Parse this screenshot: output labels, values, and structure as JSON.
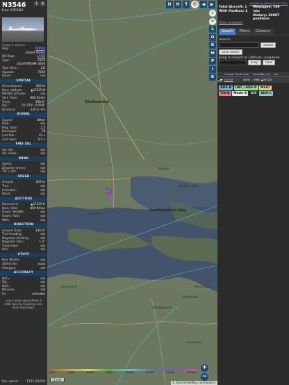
{
  "aircraft": {
    "hex_title": "N3546",
    "hex_line": "Hex:  A3F6D3",
    "photo_caption": "Image © adsc.eu",
    "details": [
      {
        "k": "Reg.:",
        "v": "N3546",
        "link": true
      },
      {
        "k": "",
        "v": "United States"
      },
      {
        "k": "DB flags:",
        "v": "LADD",
        "link": true
      },
      {
        "k": "Type:",
        "v": "GLF6"
      },
      {
        "k": "",
        "v": "GULFSTREAM G650"
      },
      {
        "k": "Type Desc.:",
        "v": "L2J"
      },
      {
        "k": "Squawk:",
        "v": "7566"
      },
      {
        "k": "Route:",
        "v": "n/a"
      }
    ]
  },
  "sections": {
    "spatial": {
      "title": "SPATIAL",
      "rows": [
        {
          "k": "Groundspeed:",
          "v": "502 kt"
        },
        {
          "k": "Baro. altitude:",
          "v": "▲37225 ft"
        },
        {
          "k": "WGS84 altitude:",
          "v": "n/a"
        },
        {
          "k": "Vert. Rate:",
          "v": "800 ft/min"
        },
        {
          "k": "Track:",
          "v": "330.0°"
        },
        {
          "k": "Pos.:",
          "v": "51.575°, 0.518°"
        },
        {
          "k": "Distance:",
          "v": "220.4 nmi"
        }
      ]
    },
    "signal": {
      "title": "SIGNAL",
      "rows": [
        {
          "k": "Source:",
          "v": "Other"
        },
        {
          "k": "RSSI:",
          "v": "n/a"
        },
        {
          "k": "Msg. Rate:",
          "v": "2.5"
        },
        {
          "k": "Messages:",
          "v": "78"
        },
        {
          "k": "Last Pos.:",
          "v": "41 s"
        },
        {
          "k": "Last Seen:",
          "v": "0.5 s"
        }
      ]
    },
    "fms": {
      "title": "FMS SEL",
      "rows": [
        {
          "k": "Sel. Alt.:",
          "v": "n/a"
        },
        {
          "k": "Sel. Head.:",
          "v": "n/a"
        }
      ]
    },
    "wind": {
      "title": "WIND",
      "rows": [
        {
          "k": "Speed:",
          "v": "n/a"
        },
        {
          "k": "Direction (from):",
          "v": "n/a"
        },
        {
          "k": "TAT / OAT:",
          "v": "n/a"
        }
      ]
    },
    "speed": {
      "title": "SPEED",
      "rows": [
        {
          "k": "Ground:",
          "v": "502 kt"
        },
        {
          "k": "True:",
          "v": "n/a"
        },
        {
          "k": "Indicated:",
          "v": "n/a"
        },
        {
          "k": "Mach:",
          "v": "n/a"
        }
      ]
    },
    "altitude": {
      "title": "ALTITUDE",
      "rows": [
        {
          "k": "Barometric:",
          "v": "▲37225 ft"
        },
        {
          "k": "Baro. Rate:",
          "v": "800 ft/min"
        },
        {
          "k": "Geom. WGS84:",
          "v": "n/a"
        },
        {
          "k": "Geom. Rate:",
          "v": "n/a"
        },
        {
          "k": "QNH:",
          "v": "n/a"
        }
      ]
    },
    "direction": {
      "title": "DIRECTION",
      "rows": [
        {
          "k": "Ground Track:",
          "v": "330.0°"
        },
        {
          "k": "True Heading:",
          "v": "n/a"
        },
        {
          "k": "Magnetic Heading:",
          "v": "n/a"
        },
        {
          "k": "Magnetic Decl.:",
          "v": "1.3°"
        },
        {
          "k": "Track Rate:",
          "v": "n/a"
        },
        {
          "k": "Roll:",
          "v": "n/a"
        }
      ]
    },
    "stuff": {
      "title": "STUFF",
      "rows": [
        {
          "k": "Nav. Modes:",
          "v": "n/a"
        },
        {
          "k": "ADS-B Ver.:",
          "v": "none"
        },
        {
          "k": "Category:",
          "v": "n/a"
        }
      ]
    },
    "accuracy": {
      "title": "ACCURACY",
      "rows": [
        {
          "k": "NACₚ:",
          "v": "n/a"
        },
        {
          "k": "SIL:",
          "v": "n/a"
        },
        {
          "k": "NACᵥ:",
          "v": "n/a"
        },
        {
          "k": "NICʙᴀʀᴏ:",
          "v": "n/a"
        },
        {
          "k": "Rc:",
          "v": "unknown"
        }
      ]
    }
  },
  "footer": {
    "learn_more": "Learn more about Mode S data type by hovering over each data label.",
    "epoch_label": "Pos. epoch:",
    "epoch_value": "1751111076"
  },
  "map": {
    "toolbar": [
      "U",
      "H",
      "T"
    ],
    "side_buttons": [
      "L",
      "O",
      "K",
      "M",
      "P",
      "I",
      "R"
    ],
    "places": {
      "chelmsford": "Chelmsford",
      "southend": "Southend-on-Sea",
      "basildon": "Basildon",
      "maldon": "Maldon",
      "colchester": "Brightlingsea",
      "gravesend": "Gravesend",
      "margate": "Herne Bay",
      "whitstable": "Whitstable",
      "canterbury": "Canterbury",
      "sittingbourne": "Sittingbourne"
    },
    "legend_ticks": [
      "1,000",
      "4,000",
      "6,000",
      "8,000",
      "10,000",
      "20,000",
      "30,000",
      "40,000+"
    ],
    "scale_label": "5 nmi",
    "attribution": "© OpenStreetMap contributors."
  },
  "right": {
    "top_link": "tar1090 on github (3.14.1714)",
    "total_aircraft": "Total Aircraft: 1",
    "with_position": "With Position: 1",
    "messages": "Messages: 749 /sec",
    "history": "History: 29907 positions",
    "stats_link": "Stats available",
    "tabs": [
      "Search",
      "Filters",
      "Columns"
    ],
    "search_label": "Search:",
    "search_button": "Search",
    "clear_search": "Clear Search",
    "jump_label": "Jump to Airport or Latitude, Longitude:",
    "jump_button": "Jump",
    "clear_button": "Clear",
    "columns": [
      "Callsign",
      "Route",
      "Type",
      "Squawk",
      "Alt. (ft)",
      "Spd"
    ],
    "row": {
      "callsign": "N3546",
      "type": "GLF6",
      "squawk": "7566",
      "alt": "▲37225"
    },
    "badges": [
      {
        "label": "ADS-B",
        "color": "#6fb3e8"
      },
      {
        "label": "UAT / ADS-R",
        "color": "#8ee28e"
      },
      {
        "label": "MLAT",
        "color": "#e8d36f"
      },
      {
        "label": "TIS-B",
        "color": "#e87a7a"
      },
      {
        "label": "Mode-S",
        "color": "#e8e8e8"
      },
      {
        "label": "AIS",
        "color": "#2b2b2b"
      },
      {
        "label": "ADS-C",
        "color": "#7ad3c8"
      }
    ]
  }
}
